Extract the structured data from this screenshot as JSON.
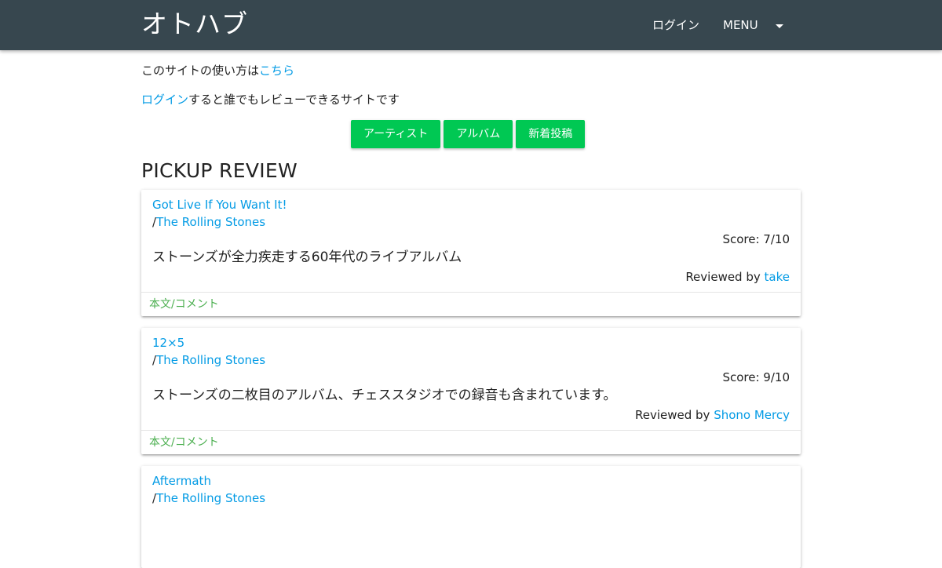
{
  "navbar": {
    "brand": "オトハブ",
    "login_label": "ログイン",
    "menu_label": "MENU",
    "background_color": "#37474f"
  },
  "intro": {
    "line1_text": "このサイトの使い方は",
    "line1_link": "こちら",
    "line2_link": "ログイン",
    "line2_text": "すると誰でもレビューできるサイトです"
  },
  "buttons": [
    {
      "label": "アーティスト"
    },
    {
      "label": "アルバム"
    },
    {
      "label": "新着投稿"
    }
  ],
  "button_color": "#00c853",
  "section_title": "PICKUP REVIEW",
  "reviews": [
    {
      "album": "Got Live If You Want It!",
      "artist_prefix": "/",
      "artist": "The Rolling Stones",
      "score": "Score: 7/10",
      "summary": "ストーンズが全力疾走する60年代のライブアルバム",
      "reviewed_by_label": "Reviewed by",
      "reviewer": "take",
      "action": "本文/コメント"
    },
    {
      "album": "12×5",
      "artist_prefix": "/",
      "artist": "The Rolling Stones",
      "score": "Score: 9/10",
      "summary": "ストーンズの二枚目のアルバム、チェススタジオでの録音も含まれています。",
      "reviewed_by_label": "Reviewed by",
      "reviewer": "Shono Mercy",
      "action": "本文/コメント"
    },
    {
      "album": "Aftermath",
      "artist_prefix": "/",
      "artist": "The Rolling Stones"
    }
  ],
  "link_color": "#039be5",
  "action_color": "#4caf50"
}
